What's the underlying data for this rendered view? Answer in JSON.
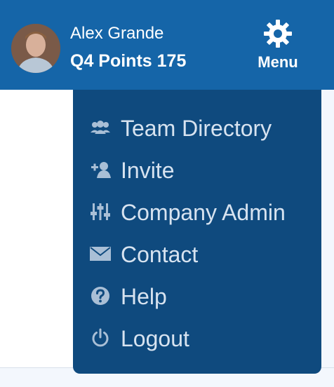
{
  "header": {
    "user_name": "Alex Grande",
    "points_text": "Q4 Points 175",
    "menu_label": "Menu"
  },
  "menu": {
    "items": [
      {
        "label": "Team Directory",
        "icon": "team-icon"
      },
      {
        "label": "Invite",
        "icon": "add-user-icon"
      },
      {
        "label": "Company Admin",
        "icon": "sliders-icon"
      },
      {
        "label": "Contact",
        "icon": "envelope-icon"
      },
      {
        "label": "Help",
        "icon": "question-icon"
      },
      {
        "label": "Logout",
        "icon": "power-icon"
      }
    ]
  },
  "colors": {
    "header_bg": "#1565a8",
    "dropdown_bg": "#0f4a7e",
    "menu_text": "#d7e3f0",
    "icon": "#a9bfd6"
  }
}
